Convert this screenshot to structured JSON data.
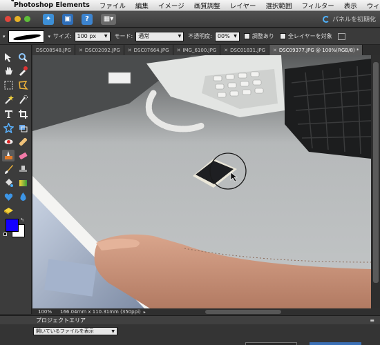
{
  "menubar": {
    "app_name": "Photoshop Elements",
    "items": [
      "ファイル",
      "編集",
      "イメージ",
      "画質調整",
      "レイヤー",
      "選択範囲",
      "フィルター",
      "表示",
      "ウィン"
    ]
  },
  "apptop": {
    "reset_label": "パネルを初期化"
  },
  "options": {
    "size_label": "サイズ:",
    "size_value": "100 px",
    "mode_label": "モード:",
    "mode_value": "通常",
    "opacity_label": "不透明度:",
    "opacity_value": "00%",
    "adjust_label": "調整あり",
    "all_layers_label": "全レイヤーを対象"
  },
  "tabs": [
    {
      "label": "DSC08548.JPG"
    },
    {
      "label": "DSC02092.JPG"
    },
    {
      "label": "DSC07664.JPG"
    },
    {
      "label": "IMG_6100.JPG"
    },
    {
      "label": "DSC01831.JPG"
    },
    {
      "label": "DSC09377.JPG @ 100%(RGB/8) *"
    }
  ],
  "status": {
    "zoom": "100%",
    "dimensions": "166.04mm x 110.31mm (350ppi)"
  },
  "project": {
    "title": "プロジェクトエリア",
    "select_value": "開いているファイルを表示"
  },
  "colors": {
    "foreground": "#1400ff",
    "background": "#ffffff"
  }
}
